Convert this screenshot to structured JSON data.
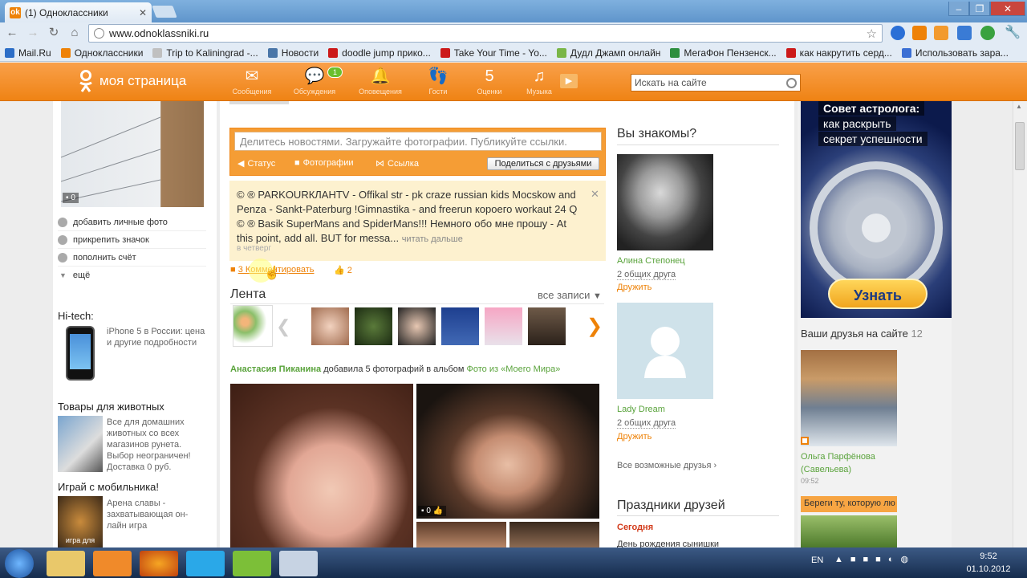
{
  "browser": {
    "tab_title": "(1) Одноклассники",
    "tab_icon": "ok-icon",
    "url": "www.odnoklassniki.ru",
    "bookmarks": [
      {
        "label": "Mail.Ru",
        "color": "#2c6ec7"
      },
      {
        "label": "Одноклассники",
        "color": "#ee8208"
      },
      {
        "label": "Trip to Kaliningrad -...",
        "color": "#c0c0c0"
      },
      {
        "label": "Новости",
        "color": "#4a76a8"
      },
      {
        "label": "doodle jump прико...",
        "color": "#cc1a1a"
      },
      {
        "label": "Take Your Time - Yo...",
        "color": "#cc1a1a"
      },
      {
        "label": "Дудл Джамп онлайн",
        "color": "#7ab648"
      },
      {
        "label": "МегаФон Пензенск...",
        "color": "#2f8f3f"
      },
      {
        "label": "как накрутить серд...",
        "color": "#cc1a1a"
      },
      {
        "label": "Использовать зара...",
        "color": "#3b6fd4"
      }
    ]
  },
  "header": {
    "logo_text": "моя страница",
    "nav": [
      {
        "label": "Сообщения",
        "icon": "envelope-icon",
        "glyph": "✉"
      },
      {
        "label": "Обсуждения",
        "icon": "chat-bubbles-icon",
        "glyph": "💬",
        "badge": "1"
      },
      {
        "label": "Оповещения",
        "icon": "bell-icon",
        "glyph": "🔔"
      },
      {
        "label": "Гости",
        "icon": "footprints-icon",
        "glyph": "👣"
      },
      {
        "label": "Оценки",
        "icon": "rating-five-icon",
        "glyph": "5"
      },
      {
        "label": "Музыка",
        "icon": "music-note-icon",
        "glyph": "♫"
      }
    ],
    "search_placeholder": "Искать на сайте"
  },
  "left": {
    "photo_comments": "0",
    "menu": [
      "добавить личные фото",
      "прикрепить значок",
      "пополнить счёт",
      "ещё"
    ],
    "hitech_title": "Hi-tech:",
    "hitech_text": "iPhone 5 в России: цена и другие подробности",
    "pets_title": "Товары для животных",
    "pets_text": "Все для домашних животных со всех магазинов рунета. Выбор неограничен! Доставка 0 руб.",
    "mobile_title": "Играй с мобильника!",
    "mobile_text": "Арена славы - захватывающая он-лайн игра",
    "mobile_img_caption": "игра для"
  },
  "center": {
    "post_placeholder": "Делитесь новостями. Загружайте фотографии. Публикуйте ссылки.",
    "post_status": "Статус",
    "post_photos": "Фотографии",
    "post_link": "Ссылка",
    "share_button": "Поделиться с друзьями",
    "status_text": "© ® PARKOURКЛAHTV - Offikal str - pk craze russian kids Mocskow and Penza - Sankt-Paterburg !Gimnastika - and freerun корое­го workaut 24 Q © ® Basik SuperMans and SpiderMans!!! Немного обо мне прошу - At this point, add all. BUT for messa...",
    "read_more": "читать дальше",
    "status_time": "в четверг",
    "comment_link": "3 Комментировать",
    "likes": "2",
    "feed_title": "Лента",
    "all_posts": "все записи",
    "feed_author": "Анастасия Пиканина",
    "feed_action": "добавила 5 фотографий в альбом",
    "feed_album": "Фото из «Моего Мира»",
    "photo_comments": "0"
  },
  "suggest": {
    "title": "Вы знакомы?",
    "people": [
      {
        "name": "Алина Степонец",
        "mutual": "2 общих друга",
        "action": "Дружить"
      },
      {
        "name": "Lady Dream",
        "mutual": "2 общих друга",
        "action": "Дружить"
      }
    ],
    "all_friends": "Все возможные друзья ›",
    "holidays_title": "Праздники друзей",
    "today": "Сегодня",
    "holiday_text": "День рождения сынишки"
  },
  "right": {
    "ad_line1": "Совет астролога:",
    "ad_line2": "как раскрыть",
    "ad_line3": "секрет успешности",
    "ad_button": "Узнать",
    "friends_online": "Ваши друзья на сайте",
    "friends_count": "12",
    "friend_name": "Ольга Парфёнова (Савельева)",
    "friend_time": "09:52",
    "promo": "Береги ту, которую лю"
  },
  "taskbar": {
    "lang": "EN",
    "time": "9:52",
    "date": "01.10.2012"
  },
  "colors": {
    "ok_orange": "#ef8314",
    "green_link": "#5aa33c",
    "taskbar": "#1c3557"
  }
}
